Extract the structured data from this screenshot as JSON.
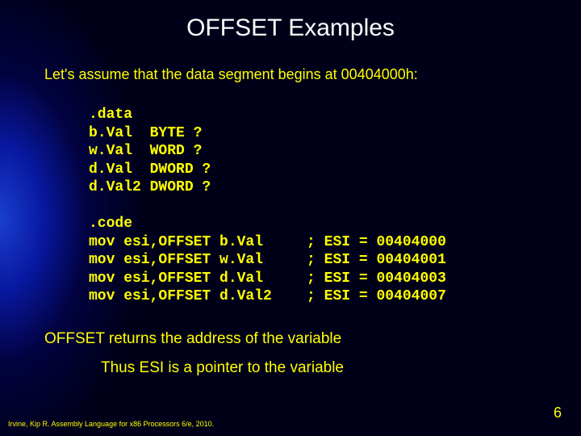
{
  "title": "OFFSET Examples",
  "intro": "Let's assume that the data segment begins at 00404000h:",
  "code": ".data\nb.Val  BYTE ?\nw.Val  WORD ?\nd.Val  DWORD ?\nd.Val2 DWORD ?\n\n.code\nmov esi,OFFSET b.Val     ; ESI = 00404000\nmov esi,OFFSET w.Val     ; ESI = 00404001\nmov esi,OFFSET d.Val     ; ESI = 00404003\nmov esi,OFFSET d.Val2    ; ESI = 00404007",
  "summary1": "OFFSET returns the address of the variable",
  "summary2": "Thus ESI is a pointer to the variable",
  "footer": "Irvine, Kip R. Assembly Language for x86 Processors 6/e, 2010.",
  "page": "6"
}
